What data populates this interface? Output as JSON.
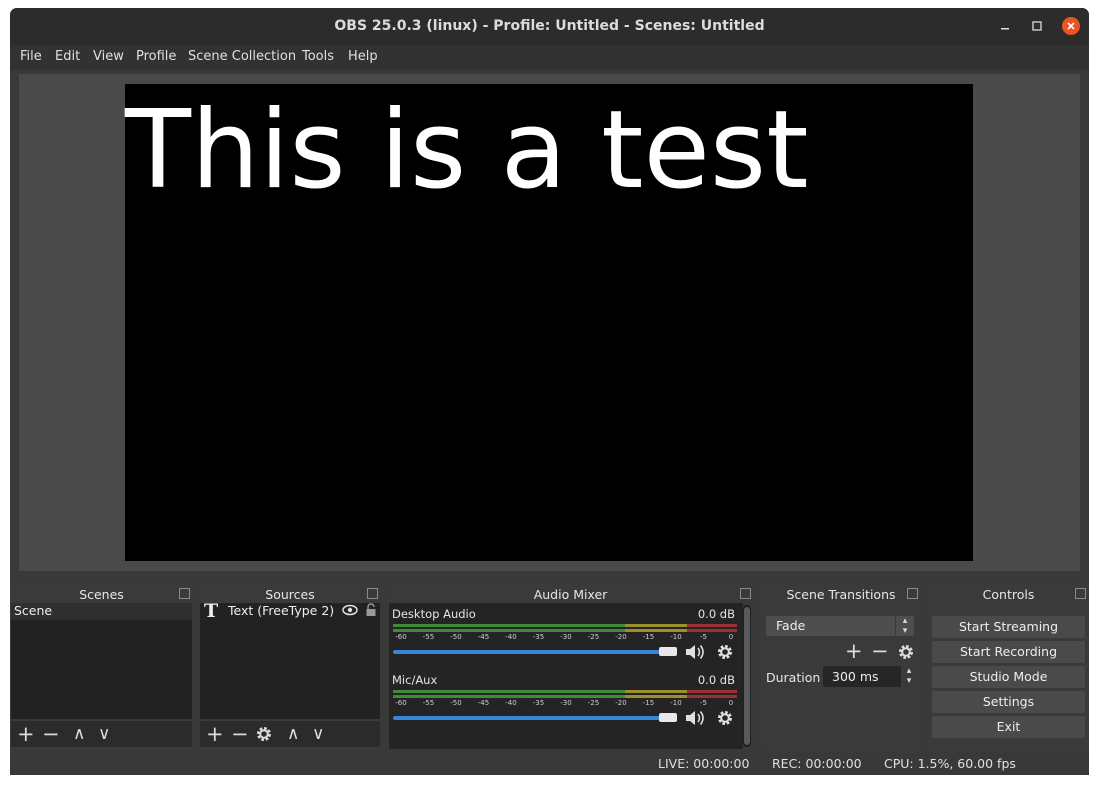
{
  "window": {
    "title": "OBS 25.0.3 (linux) - Profile: Untitled - Scenes: Untitled"
  },
  "menu": [
    "File",
    "Edit",
    "View",
    "Profile",
    "Scene Collection",
    "Tools",
    "Help"
  ],
  "preview": {
    "text": "This is a test"
  },
  "docks": {
    "scenes": {
      "title": "Scenes",
      "items": [
        "Scene"
      ]
    },
    "sources": {
      "title": "Sources",
      "items": [
        {
          "label": "Text (FreeType 2)",
          "icon": "text-icon"
        }
      ]
    },
    "mixer": {
      "title": "Audio Mixer",
      "channels": [
        {
          "name": "Desktop Audio",
          "db": "0.0 dB",
          "volume": 1.0
        },
        {
          "name": "Mic/Aux",
          "db": "0.0 dB",
          "volume": 1.0
        }
      ],
      "scale": [
        "-60",
        "-55",
        "-50",
        "-45",
        "-40",
        "-35",
        "-30",
        "-25",
        "-20",
        "-15",
        "-10",
        "-5",
        "0"
      ]
    },
    "transitions": {
      "title": "Scene Transitions",
      "selected": "Fade",
      "duration_label": "Duration",
      "duration_value": "300 ms"
    },
    "controls": {
      "title": "Controls",
      "buttons": [
        "Start Streaming",
        "Start Recording",
        "Studio Mode",
        "Settings",
        "Exit"
      ]
    }
  },
  "status": {
    "live": "LIVE: 00:00:00",
    "rec": "REC: 00:00:00",
    "cpu": "CPU: 1.5%, 60.00 fps"
  },
  "icons": {
    "add": "+",
    "remove": "−",
    "up": "∧",
    "down": "∨"
  },
  "colors": {
    "close_button": "#e95420",
    "fader": "#3a86d6",
    "meter_green": "#3d8b3b",
    "meter_yellow": "#9b8e2c",
    "meter_red": "#9b3131"
  }
}
